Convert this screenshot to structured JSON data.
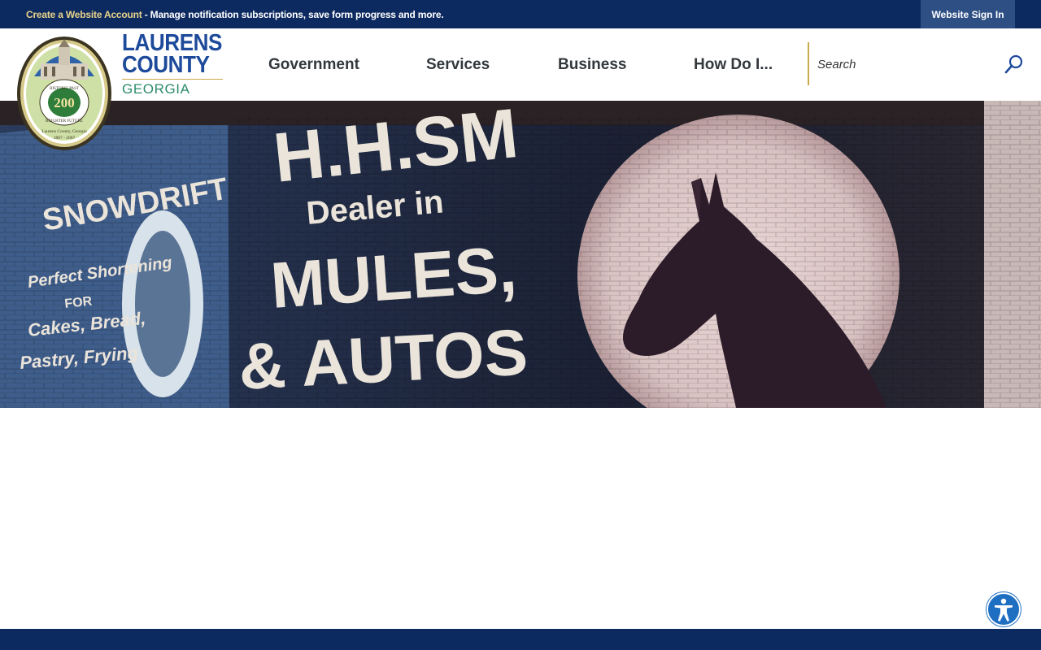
{
  "topbar": {
    "create_link": "Create a Website Account",
    "message": " - Manage notification subscriptions, save form progress and more.",
    "signin_label": "Website Sign In"
  },
  "brand": {
    "line1": "LAURENS",
    "line2": "COUNTY",
    "line3": "GEORGIA",
    "seal_icon": "county-seal-logo",
    "seal_text": {
      "ring_top": "HISTORIC PAST",
      "ring_bottom": "BRIGHTER FUTURE",
      "center": "200",
      "caption": "Laurens County, Georgia",
      "years": "1807 - 2007"
    }
  },
  "nav": {
    "items": [
      "Government",
      "Services",
      "Business",
      "How Do I..."
    ]
  },
  "search": {
    "placeholder": "Search",
    "icon": "search-icon"
  },
  "hero": {
    "mural_text": {
      "left_title": "SNOWDRIFT",
      "left_lines": [
        "Perfect Shortening",
        "FOR",
        "Cakes, Bread,",
        "Pastry, Frying"
      ],
      "main_top": "H.H.SM",
      "main_line1": "Dealer in",
      "main_line2": "MULES,",
      "main_line3": "& AUTOS"
    }
  },
  "accessibility": {
    "icon": "accessibility-icon"
  },
  "colors": {
    "navy": "#0d2a60",
    "brand_blue": "#1d4a9a",
    "brand_green": "#2c8c6b",
    "gold": "#c9a94a",
    "accent_blue": "#1e6fc2"
  }
}
